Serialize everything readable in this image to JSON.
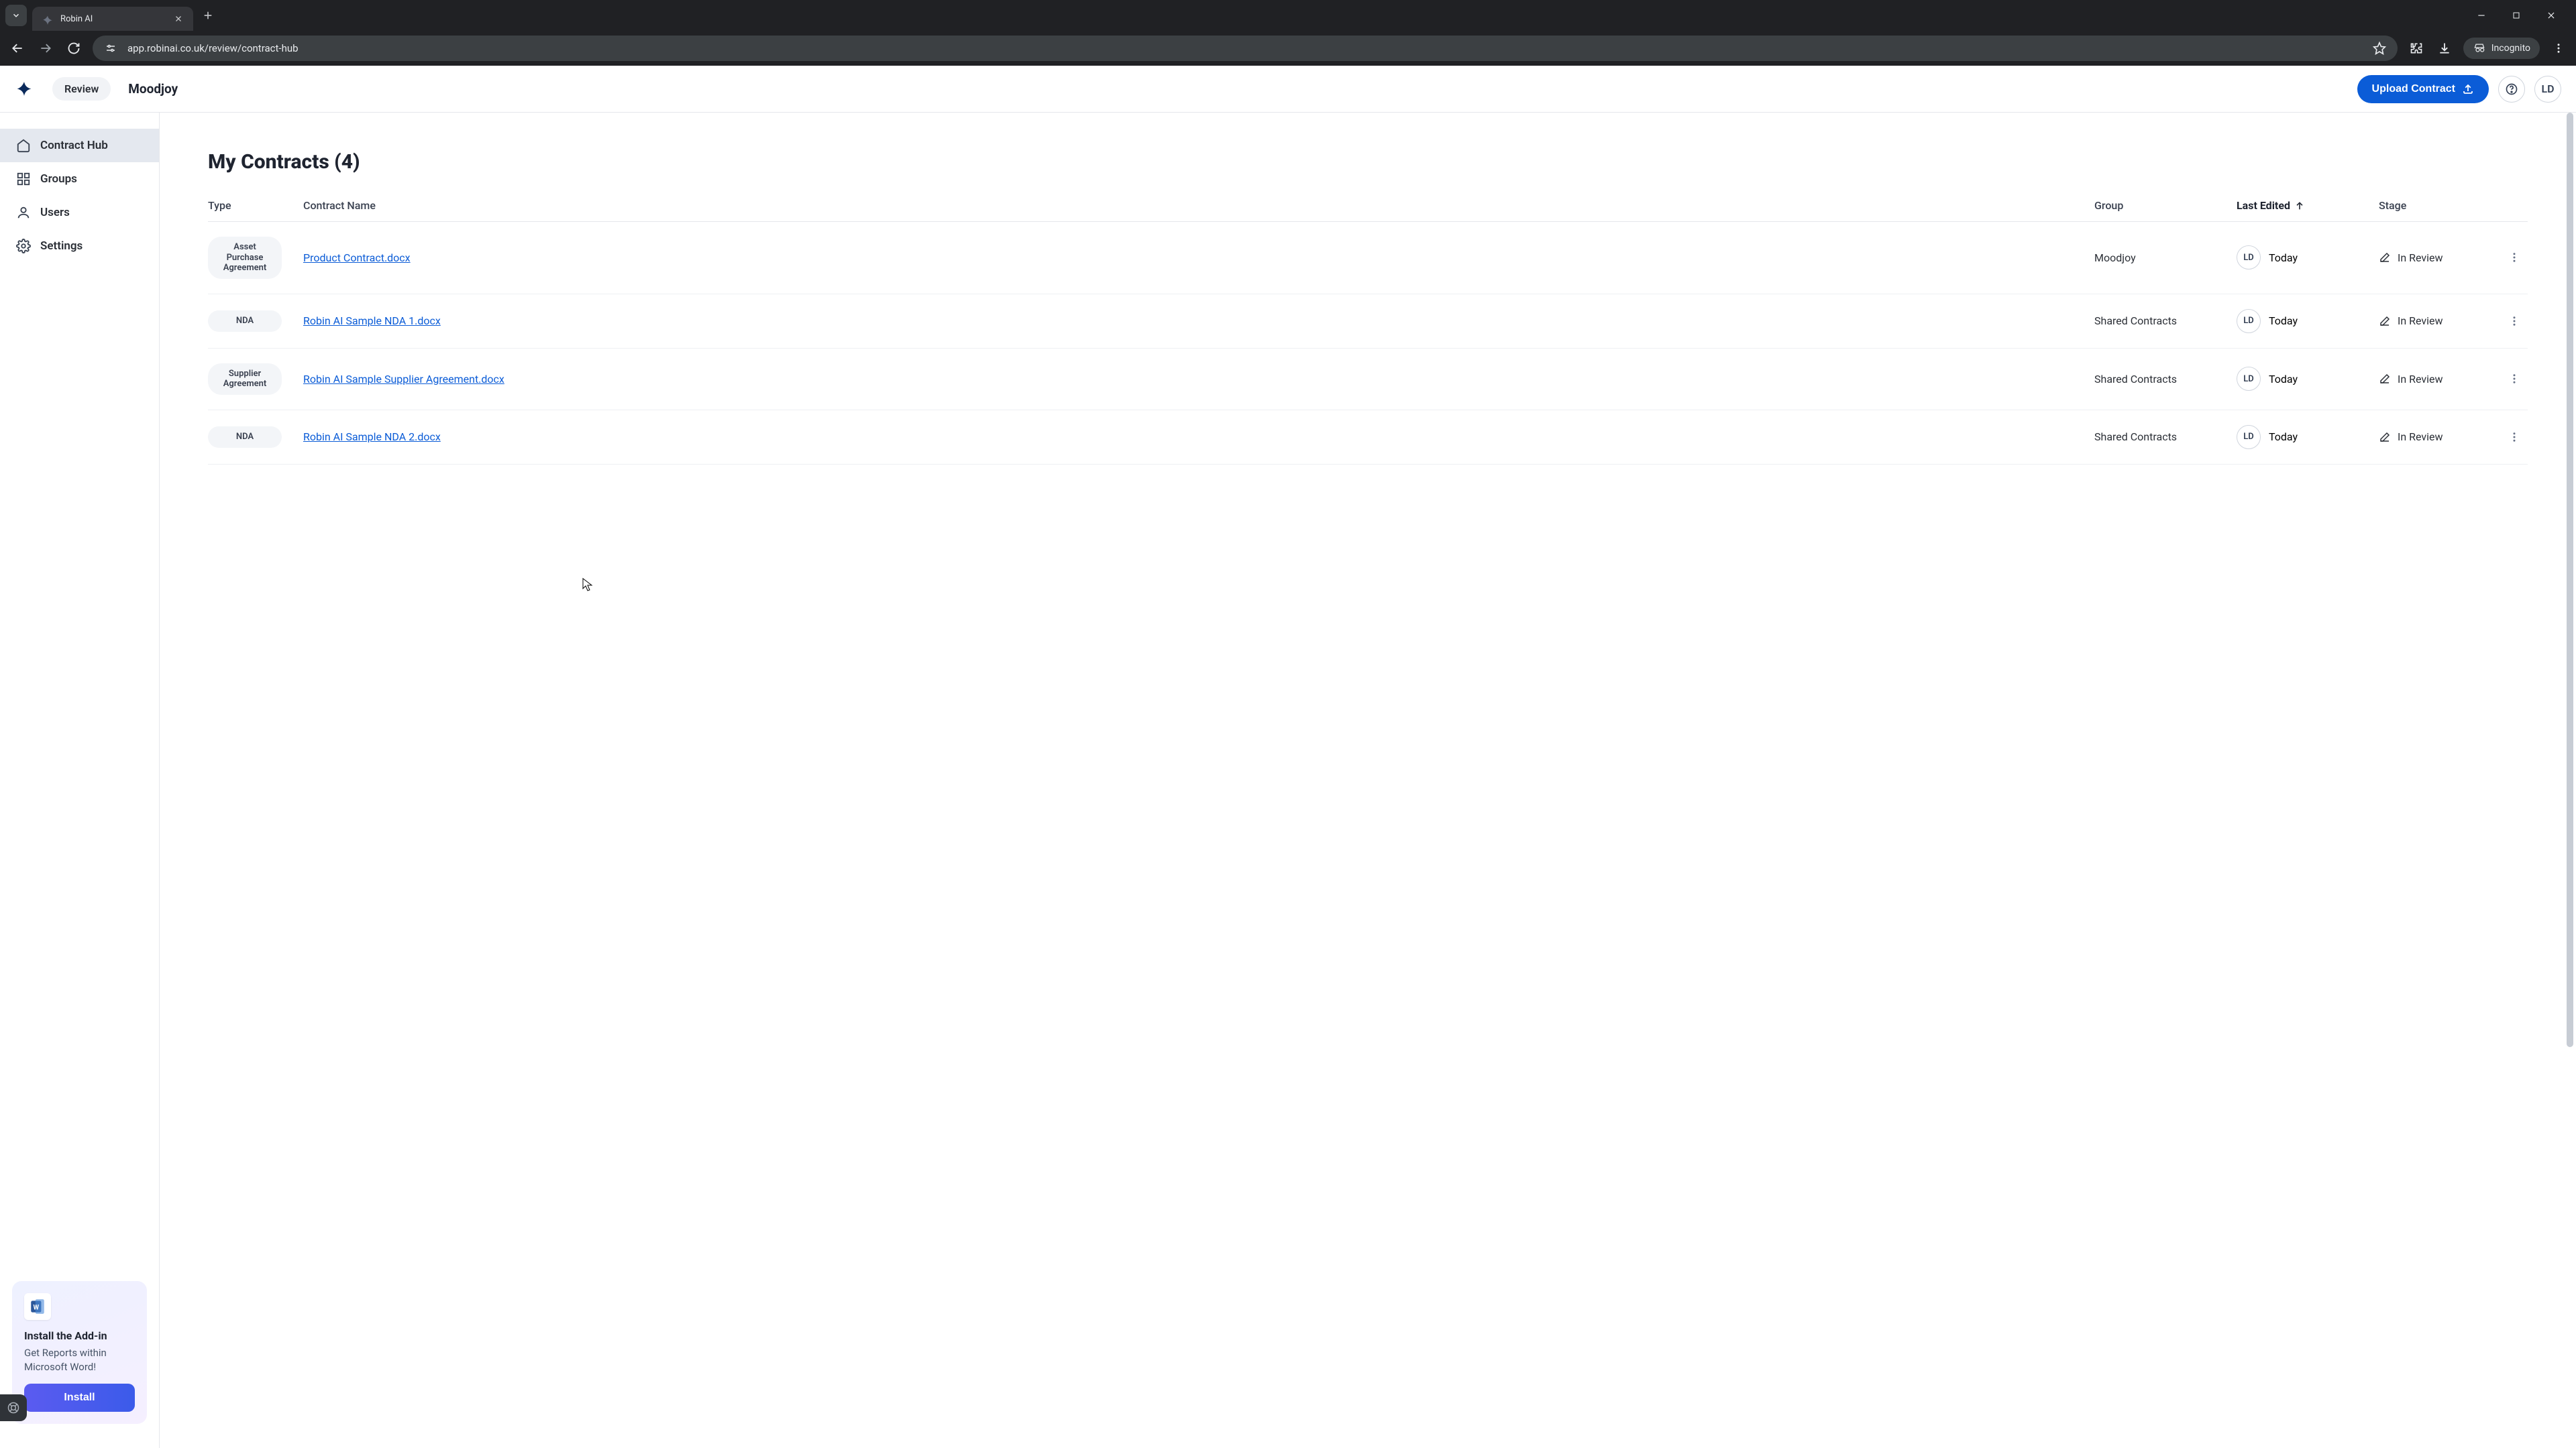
{
  "browser": {
    "tab_title": "Robin AI",
    "url": "app.robinai.co.uk/review/contract-hub",
    "incognito_label": "Incognito"
  },
  "header": {
    "review_pill": "Review",
    "org_name": "Moodjoy",
    "upload_button": "Upload Contract",
    "avatar_initials": "LD"
  },
  "sidebar": {
    "items": [
      {
        "key": "contract-hub",
        "label": "Contract Hub",
        "active": true
      },
      {
        "key": "groups",
        "label": "Groups",
        "active": false
      },
      {
        "key": "users",
        "label": "Users",
        "active": false
      },
      {
        "key": "settings",
        "label": "Settings",
        "active": false
      }
    ],
    "addin": {
      "title": "Install the Add-in",
      "body": "Get Reports within Microsoft Word!",
      "button": "Install"
    }
  },
  "main": {
    "title": "My Contracts (4)",
    "columns": {
      "type": "Type",
      "name": "Contract Name",
      "group": "Group",
      "edited": "Last Edited",
      "stage": "Stage"
    },
    "sort": {
      "column": "edited",
      "direction": "asc"
    },
    "rows": [
      {
        "type": "Asset Purchase Agreement",
        "name": "Product Contract.docx",
        "group": "Moodjoy",
        "editor_initials": "LD",
        "edited": "Today",
        "stage": "In Review"
      },
      {
        "type": "NDA",
        "name": "Robin AI Sample NDA 1.docx",
        "group": "Shared Contracts",
        "editor_initials": "LD",
        "edited": "Today",
        "stage": "In Review"
      },
      {
        "type": "Supplier Agreement",
        "name": "Robin AI Sample Supplier Agreement.docx",
        "group": "Shared Contracts",
        "editor_initials": "LD",
        "edited": "Today",
        "stage": "In Review"
      },
      {
        "type": "NDA",
        "name": "Robin AI Sample NDA 2.docx",
        "group": "Shared Contracts",
        "editor_initials": "LD",
        "edited": "Today",
        "stage": "In Review"
      }
    ]
  }
}
